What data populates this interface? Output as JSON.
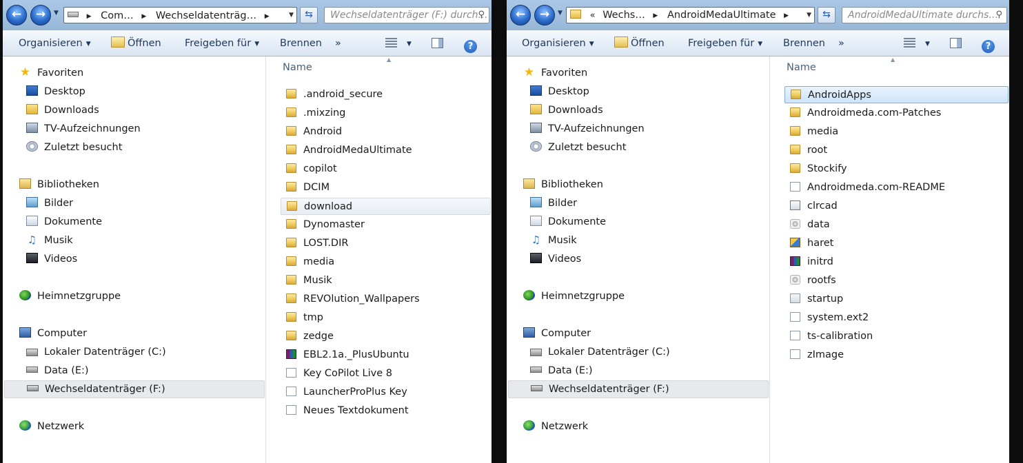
{
  "left": {
    "breadcrumbs": [
      "Com…",
      "Wechseldatenträg…"
    ],
    "search_placeholder": "Wechseldatenträger (F:) durch…",
    "toolbar": {
      "organize": "Organisieren",
      "open": "Öffnen",
      "share": "Freigeben für",
      "burn": "Brennen",
      "more": "»"
    },
    "nav": {
      "favorites": "Favoriten",
      "desktop": "Desktop",
      "downloads": "Downloads",
      "tv": "TV-Aufzeichnungen",
      "recent": "Zuletzt besucht",
      "libraries": "Bibliotheken",
      "pictures": "Bilder",
      "documents": "Dokumente",
      "music": "Musik",
      "videos": "Videos",
      "homegroup": "Heimnetzgruppe",
      "computer": "Computer",
      "drive_c": "Lokaler Datenträger (C:)",
      "drive_e": "Data (E:)",
      "drive_f": "Wechseldatenträger (F:)",
      "network": "Netzwerk"
    },
    "column_header": "Name",
    "files": [
      {
        "name": ".android_secure",
        "icon": "folder-icon"
      },
      {
        "name": ".mixzing",
        "icon": "folder-icon"
      },
      {
        "name": "Android",
        "icon": "folder-icon"
      },
      {
        "name": "AndroidMedaUltimate",
        "icon": "folder-icon"
      },
      {
        "name": "copilot",
        "icon": "folder-icon"
      },
      {
        "name": "DCIM",
        "icon": "folder-icon"
      },
      {
        "name": "download",
        "icon": "folder-icon",
        "state": "hover"
      },
      {
        "name": "Dynomaster",
        "icon": "folder-icon"
      },
      {
        "name": "LOST.DIR",
        "icon": "folder-icon"
      },
      {
        "name": "media",
        "icon": "folder-icon"
      },
      {
        "name": "Musik",
        "icon": "folder-icon"
      },
      {
        "name": "REVOlution_Wallpapers",
        "icon": "folder-icon"
      },
      {
        "name": "tmp",
        "icon": "folder-icon"
      },
      {
        "name": "zedge",
        "icon": "folder-icon"
      },
      {
        "name": "EBL2.1a._PlusUbuntu",
        "icon": "rar-archive-icon"
      },
      {
        "name": "Key CoPilot Live 8",
        "icon": "text-file-icon"
      },
      {
        "name": "LauncherProPlus Key",
        "icon": "text-file-icon"
      },
      {
        "name": "Neues Textdokument",
        "icon": "text-file-icon"
      }
    ]
  },
  "right": {
    "breadcrumbs": [
      "Wechs…",
      "AndroidMedaUltimate"
    ],
    "search_placeholder": "AndroidMedaUltimate durchs…",
    "toolbar": {
      "organize": "Organisieren",
      "open": "Öffnen",
      "share": "Freigeben für",
      "burn": "Brennen",
      "more": "»"
    },
    "nav": {
      "favorites": "Favoriten",
      "desktop": "Desktop",
      "downloads": "Downloads",
      "tv": "TV-Aufzeichnungen",
      "recent": "Zuletzt besucht",
      "libraries": "Bibliotheken",
      "pictures": "Bilder",
      "documents": "Dokumente",
      "music": "Musik",
      "videos": "Videos",
      "homegroup": "Heimnetzgruppe",
      "computer": "Computer",
      "drive_c": "Lokaler Datenträger (C:)",
      "drive_e": "Data (E:)",
      "drive_f": "Wechseldatenträger (F:)",
      "network": "Netzwerk"
    },
    "column_header": "Name",
    "files": [
      {
        "name": "AndroidApps",
        "icon": "folder-icon",
        "state": "selected"
      },
      {
        "name": "Androidmeda.com-Patches",
        "icon": "folder-icon"
      },
      {
        "name": "media",
        "icon": "folder-icon"
      },
      {
        "name": "root",
        "icon": "folder-icon"
      },
      {
        "name": "Stockify",
        "icon": "folder-icon"
      },
      {
        "name": "Androidmeda.com-README",
        "icon": "text-file-icon"
      },
      {
        "name": "clrcad",
        "icon": "executable-icon"
      },
      {
        "name": "data",
        "icon": "generic-file-icon"
      },
      {
        "name": "haret",
        "icon": "app-icon"
      },
      {
        "name": "initrd",
        "icon": "rar-archive-icon"
      },
      {
        "name": "rootfs",
        "icon": "generic-file-icon"
      },
      {
        "name": "startup",
        "icon": "config-file-icon"
      },
      {
        "name": "system.ext2",
        "icon": "blank-file-icon"
      },
      {
        "name": "ts-calibration",
        "icon": "blank-file-icon"
      },
      {
        "name": "zImage",
        "icon": "blank-file-icon"
      }
    ]
  }
}
